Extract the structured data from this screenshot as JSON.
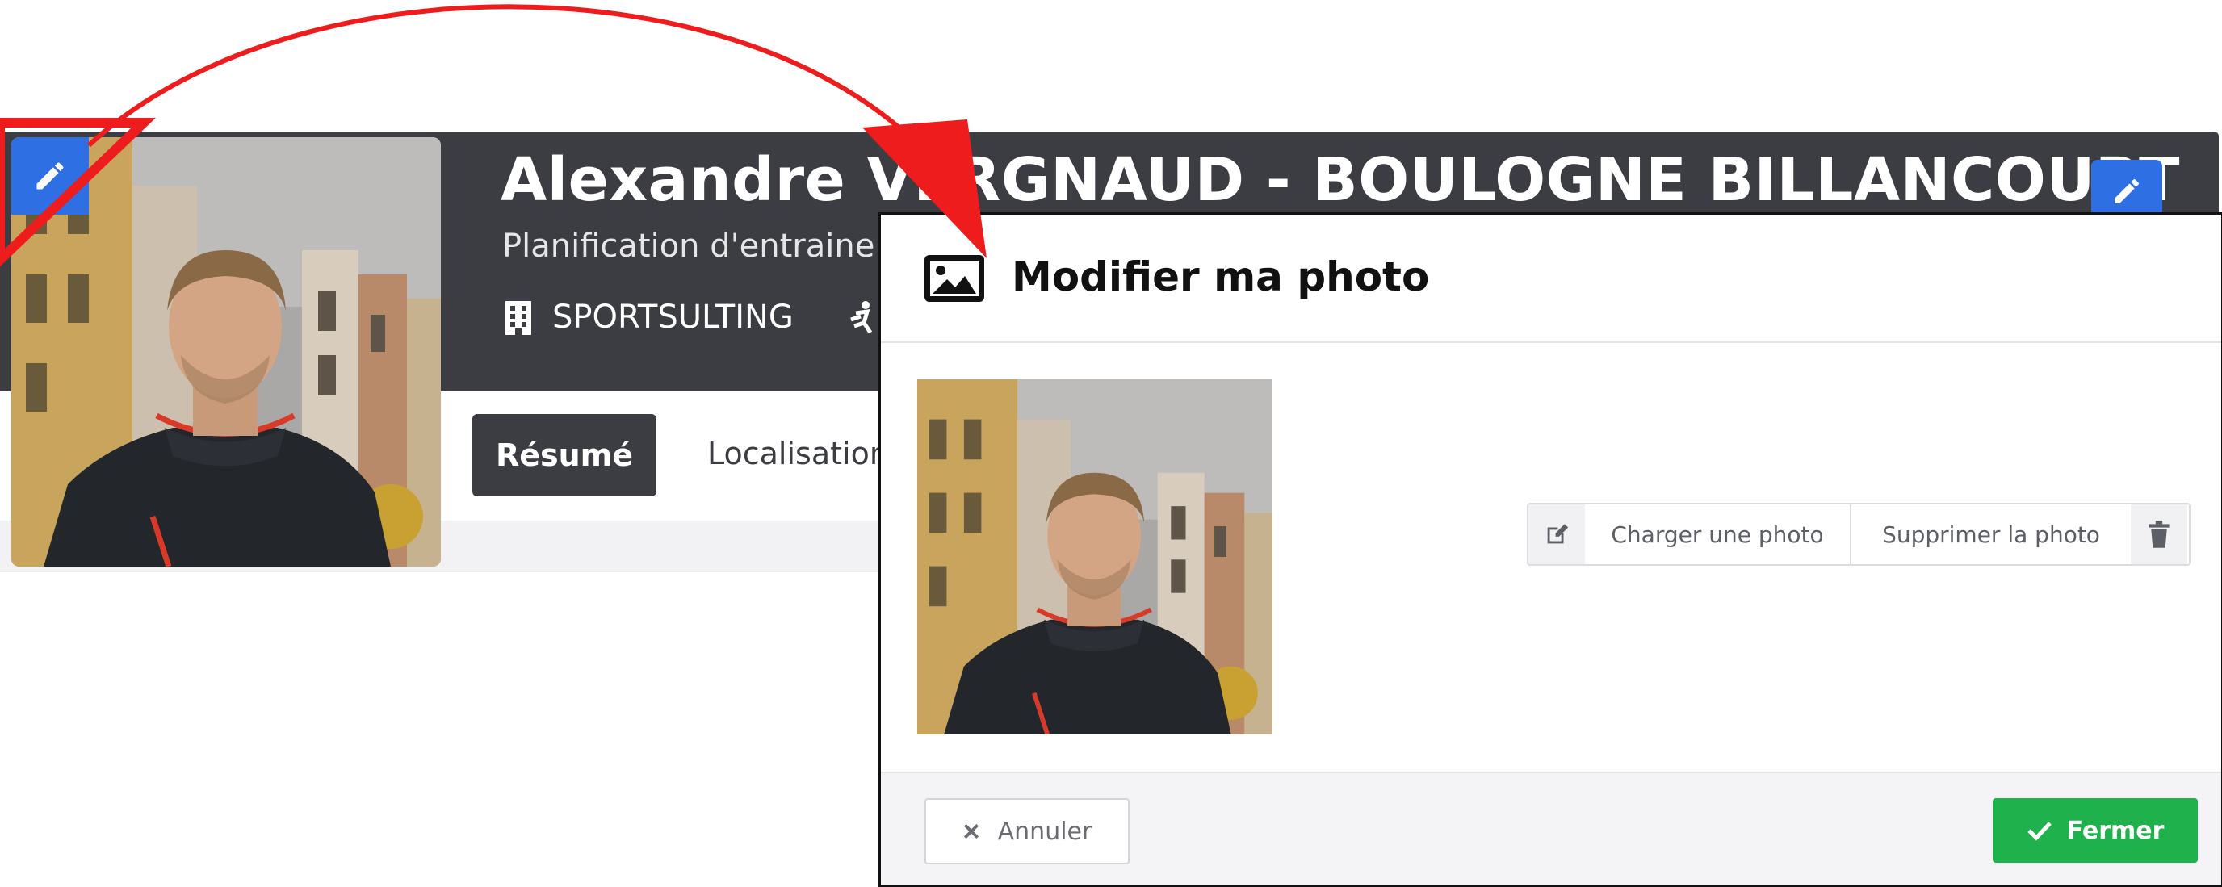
{
  "profile": {
    "name": "Alexandre VERGNAUD - BOULOGNE BILLANCOURT",
    "subtitle": "Planification d'entraine",
    "company": "SPORTSULTING",
    "icons": {
      "avatar_edit": "pencil-icon",
      "name_edit": "pencil-icon",
      "company": "building-icon",
      "extra": "sport-icon"
    },
    "tabs": [
      {
        "label": "Résumé",
        "active": true
      },
      {
        "label": "Localisation",
        "active": false
      }
    ]
  },
  "modal": {
    "title": "Modifier ma photo",
    "title_icon": "image-icon",
    "upload_label": "Charger une photo",
    "delete_label": "Supprimer la photo",
    "upload_icon": "edit-square-icon",
    "delete_icon": "trash-icon",
    "cancel_label": "Annuler",
    "cancel_icon": "close-icon",
    "close_label": "Fermer",
    "close_icon": "check-icon"
  },
  "colors": {
    "header_dark": "#3c3d42",
    "accent_blue": "#2f6fe4",
    "success_green": "#1fb14b",
    "annotation_red": "#ee1c1c"
  }
}
